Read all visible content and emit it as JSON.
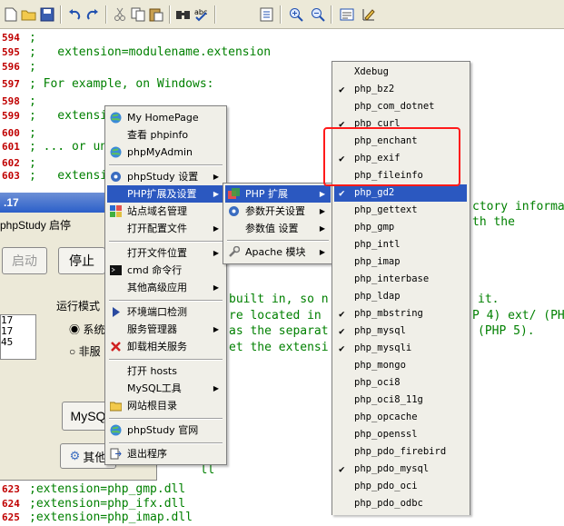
{
  "toolbar": {
    "icons": [
      "new-icon",
      "open-icon",
      "save-icon",
      "undo-icon",
      "redo-icon",
      "cut-icon",
      "copy-icon",
      "paste-icon",
      "find-icon",
      "spellcheck-icon",
      "replace-icon",
      "zoom-in-icon",
      "zoom-out-icon",
      "wordwrap-icon",
      "edit-icon"
    ],
    "spellcheck_label": "abc"
  },
  "editor": {
    "lines": [
      {
        "num": "594",
        "text": ";"
      },
      {
        "num": "595",
        "text": ";   extension=modulename.extension"
      },
      {
        "num": "596",
        "text": ";"
      },
      {
        "num": "597",
        "text": "; For example, on Windows:"
      },
      {
        "num": "598",
        "text": ";"
      },
      {
        "num": "599",
        "text": ";   extensio"
      },
      {
        "num": "600",
        "text": ";"
      },
      {
        "num": "601",
        "text": "; ... or un"
      },
      {
        "num": "602",
        "text": ";"
      },
      {
        "num": "603",
        "text": ";   extensio"
      }
    ],
    "bottom_lines": [
      {
        "num": "623",
        "text": ";extension=php_gmp.dll"
      },
      {
        "num": "624",
        "text": ";extension=php_ifx.dll"
      },
      {
        "num": "625",
        "text": ";extension=php_imap.dll"
      }
    ],
    "partial_line_a": "  ll",
    "right_fragments": [
      "ctory informa",
      "th the",
      "built in, so n",
      "it.",
      "re located in",
      "P 4) ext/ (PH",
      "as the separat",
      "(PHP 5).",
      "et the extensi"
    ]
  },
  "studywin": {
    "title": ".17",
    "caption": "phpStudy 启停",
    "start_label": "启动",
    "stop_label": "停止",
    "run_mode_label": "运行模式",
    "radio_system": "系统",
    "radio_non": "非服",
    "list_items": [
      "17",
      "17",
      "45"
    ],
    "mysql_label": "MySQ",
    "other_label": "其他"
  },
  "main_menu": {
    "items": [
      {
        "label": "My HomePage",
        "icon": "globe-icon"
      },
      {
        "label": "查看 phpinfo",
        "icon": ""
      },
      {
        "label": "phpMyAdmin",
        "icon": "globe-icon"
      },
      {
        "label": "phpStudy 设置",
        "icon": "gear-icon",
        "sub": true
      },
      {
        "label": "PHP扩展及设置",
        "icon": "",
        "sub": true,
        "highlight": true
      },
      {
        "label": "站点域名管理",
        "icon": "sites-icon"
      },
      {
        "label": "打开配置文件",
        "icon": "",
        "sub": true
      },
      {
        "label": "打开文件位置",
        "icon": "",
        "sub": true
      },
      {
        "label": "cmd 命令行",
        "icon": "terminal-icon"
      },
      {
        "label": "其他高级应用",
        "icon": "",
        "sub": true
      },
      {
        "label": "环境端口检测",
        "icon": "arrow-icon"
      },
      {
        "label": "服务管理器",
        "icon": "",
        "sub": true
      },
      {
        "label": "卸载相关服务",
        "icon": "uninstall-icon"
      },
      {
        "label": "打开 hosts",
        "icon": ""
      },
      {
        "label": "MySQL工具",
        "icon": "",
        "sub": true
      },
      {
        "label": "网站根目录",
        "icon": "folder-icon"
      },
      {
        "label": "phpStudy 官网",
        "icon": "globe-icon"
      },
      {
        "label": "退出程序",
        "icon": "exit-icon"
      }
    ]
  },
  "sub_menu": {
    "items": [
      {
        "label": "PHP 扩展",
        "icon": "puzzle-icon",
        "sub": true,
        "highlight": true
      },
      {
        "label": "参数开关设置",
        "icon": "gear-icon",
        "sub": true
      },
      {
        "label": "参数值 设置",
        "icon": "",
        "sub": true
      },
      {
        "label": "Apache 模块",
        "icon": "wrench-icon",
        "sub": true
      }
    ]
  },
  "ext_menu": {
    "items": [
      {
        "label": "Xdebug",
        "checked": false
      },
      {
        "label": "php_bz2",
        "checked": true
      },
      {
        "label": "php_com_dotnet",
        "checked": false
      },
      {
        "label": "php_curl",
        "checked": true
      },
      {
        "label": "php_enchant",
        "checked": false
      },
      {
        "label": "php_exif",
        "checked": true
      },
      {
        "label": "php_fileinfo",
        "checked": false
      },
      {
        "label": "php_gd2",
        "checked": true,
        "highlight": true
      },
      {
        "label": "php_gettext",
        "checked": false
      },
      {
        "label": "php_gmp",
        "checked": false
      },
      {
        "label": "php_intl",
        "checked": false
      },
      {
        "label": "php_imap",
        "checked": false
      },
      {
        "label": "php_interbase",
        "checked": false
      },
      {
        "label": "php_ldap",
        "checked": false
      },
      {
        "label": "php_mbstring",
        "checked": true
      },
      {
        "label": "php_mysql",
        "checked": true
      },
      {
        "label": "php_mysqli",
        "checked": true
      },
      {
        "label": "php_mongo",
        "checked": false
      },
      {
        "label": "php_oci8",
        "checked": false
      },
      {
        "label": "php_oci8_11g",
        "checked": false
      },
      {
        "label": "php_opcache",
        "checked": false
      },
      {
        "label": "php_openssl",
        "checked": false
      },
      {
        "label": "php_pdo_firebird",
        "checked": false
      },
      {
        "label": "php_pdo_mysql",
        "checked": true
      },
      {
        "label": "php_pdo_oci",
        "checked": false
      },
      {
        "label": "php_pdo_odbc",
        "checked": false
      }
    ],
    "check_glyph": "✔"
  },
  "colors": {
    "highlight": "#2b58c0",
    "comment": "#008000",
    "line_number": "#c00000",
    "annotation_box": "#ff1a1a"
  }
}
